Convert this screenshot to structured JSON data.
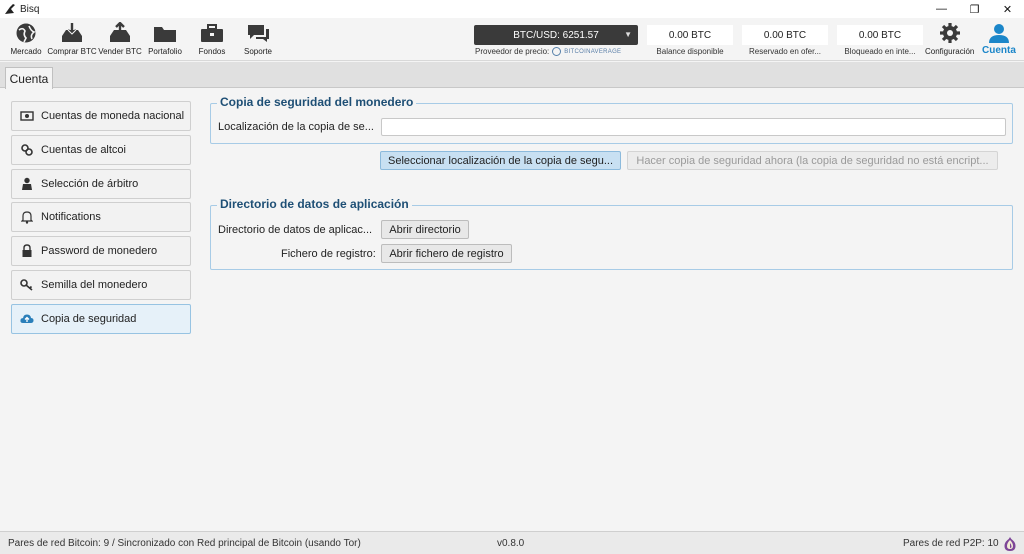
{
  "window": {
    "title": "Bisq"
  },
  "nav": {
    "items": [
      {
        "label": "Mercado",
        "icon": "globe-icon"
      },
      {
        "label": "Comprar BTC",
        "icon": "buy-icon"
      },
      {
        "label": "Vender BTC",
        "icon": "sell-icon"
      },
      {
        "label": "Portafolio",
        "icon": "folder-icon"
      },
      {
        "label": "Fondos",
        "icon": "briefcase-icon"
      },
      {
        "label": "Soporte",
        "icon": "chat-icon"
      }
    ],
    "price": {
      "value": "BTC/USD: 6251.57",
      "provider_label": "Proveedor de precio:",
      "provider_name": "BitcoinAverage"
    },
    "balances": [
      {
        "value": "0.00 BTC",
        "caption": "Balance disponible"
      },
      {
        "value": "0.00 BTC",
        "caption": "Reservado en ofer..."
      },
      {
        "value": "0.00 BTC",
        "caption": "Bloqueado en inte..."
      }
    ],
    "settings_label": "Configuración",
    "account_label": "Cuenta"
  },
  "tabs": [
    {
      "label": "Cuenta"
    }
  ],
  "sidebar": {
    "items": [
      {
        "label": "Cuentas de moneda nacional",
        "icon": "money-icon"
      },
      {
        "label": "Cuentas de altcoi",
        "icon": "link-icon"
      },
      {
        "label": "Selección de árbitro",
        "icon": "arbitrator-icon"
      },
      {
        "label": "Notifications",
        "icon": "bell-icon"
      },
      {
        "label": "Password de monedero",
        "icon": "lock-icon"
      },
      {
        "label": "Semilla del monedero",
        "icon": "key-icon"
      },
      {
        "label": "Copia de seguridad",
        "icon": "cloud-upload-icon",
        "active": true
      }
    ]
  },
  "backup": {
    "title": "Copia de seguridad del monedero",
    "location_label": "Localización de la copia de se...",
    "location_value": "",
    "select_button": "Seleccionar localización de la copia de segu...",
    "backup_now_button": "Hacer copia de seguridad ahora (la copia de seguridad no está encript..."
  },
  "datadir": {
    "title": "Directorio de datos de aplicación",
    "dir_label": "Directorio de datos de aplicac...",
    "dir_button": "Abrir directorio",
    "log_label": "Fichero de registro:",
    "log_button": "Abrir fichero de registro"
  },
  "footer": {
    "left": "Pares de red Bitcoin: 9 / Sincronizado con Red principal de Bitcoin (usando Tor)",
    "version": "v0.8.0",
    "right": "Pares de red P2P: 10"
  },
  "colors": {
    "accent": "#1b86c9",
    "group_border": "#a7cbe6",
    "primary_button": "#c8e0f2"
  }
}
